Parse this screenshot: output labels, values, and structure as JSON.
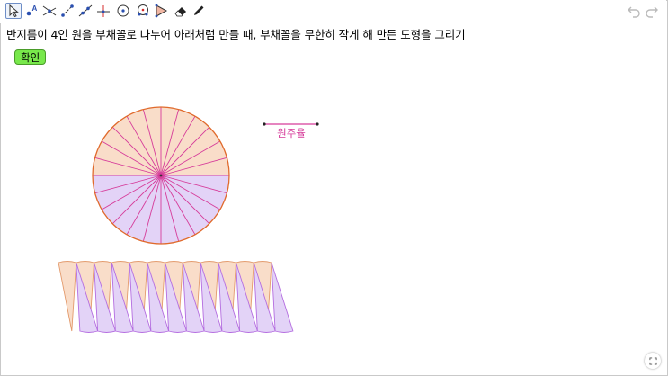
{
  "toolbar": {
    "tools": [
      {
        "icon": "move-arrow-icon"
      },
      {
        "icon": "point-icon"
      },
      {
        "icon": "intersect-icon"
      },
      {
        "icon": "segment-icon"
      },
      {
        "icon": "line-icon"
      },
      {
        "icon": "perpendicular-icon"
      },
      {
        "icon": "circle-center-icon"
      },
      {
        "icon": "circle-through-points-icon"
      },
      {
        "icon": "angle-icon"
      },
      {
        "icon": "eraser-icon"
      },
      {
        "icon": "pen-icon"
      }
    ],
    "undo_icon": "undo-icon",
    "redo_icon": "redo-icon"
  },
  "task": {
    "instruction": "반지름이 4인 원을 부채꼴로 나누어 아래처럼 만들 때, 부채꼴을 무한히 작게 해 만든 도형을 그리기",
    "confirm_label": "확인"
  },
  "figure": {
    "sector_count": 24,
    "circumference_label": "원주율",
    "colors": {
      "top_fill": "#f9ddc9",
      "bottom_fill": "#e3d3f7",
      "outline": "#e06a2c",
      "spokes": "#d63c9a",
      "strip_stroke_top": "#e39a6c",
      "strip_stroke_bottom": "#b46de0",
      "label": "#d63c9a"
    }
  },
  "fullscreen_icon": "fullscreen-icon"
}
